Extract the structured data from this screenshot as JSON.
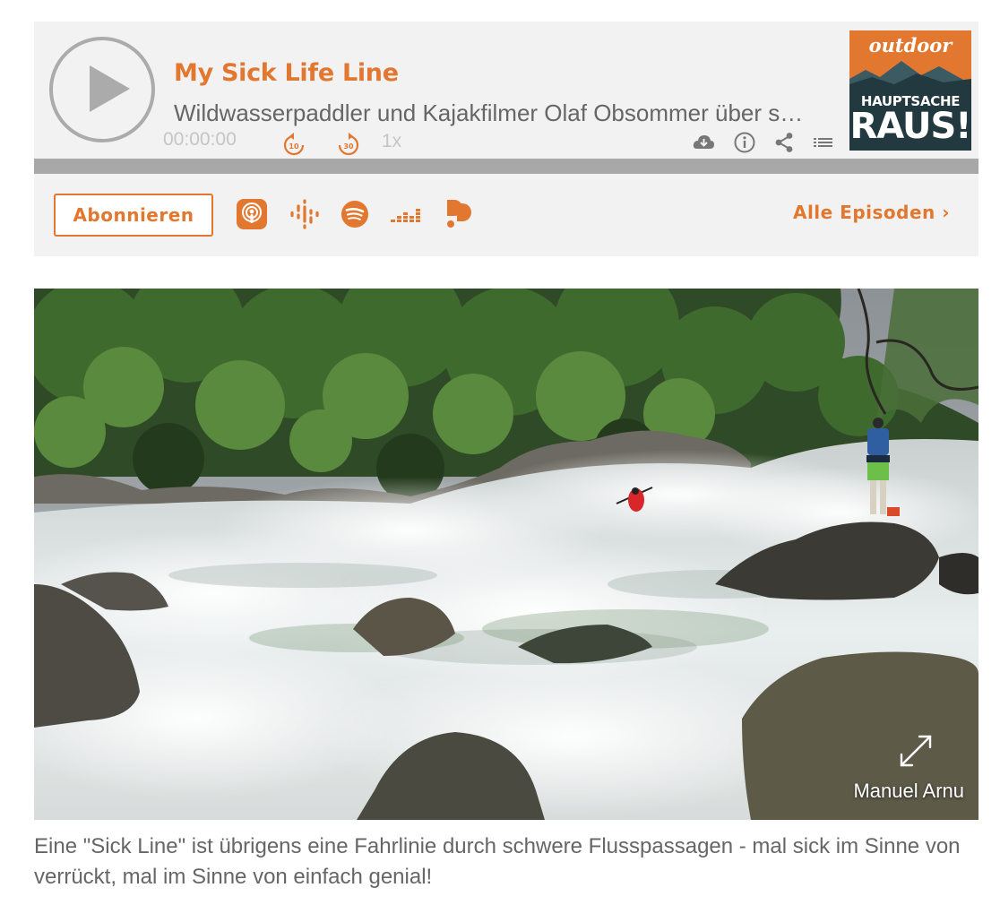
{
  "player": {
    "title": "My Sick Life Line",
    "description": "Wildwasserpaddler und Kajakfilmer Olaf Obsommer über sein Leben in der Natur",
    "time": "00:00:00",
    "skip_back_seconds": "10",
    "skip_forward_seconds": "30",
    "speed": "1x",
    "progress": 0,
    "icons": [
      "play-icon",
      "skip-back-icon",
      "skip-forward-icon",
      "download-icon",
      "info-icon",
      "share-icon",
      "playlist-icon"
    ],
    "cover": {
      "top_text": "outdoor",
      "line1": "HAUPTSACHE",
      "line2": "RAUS!"
    },
    "subscribe_label": "Abonnieren",
    "platforms": [
      "apple-podcasts-icon",
      "google-podcasts-icon",
      "spotify-icon",
      "deezer-icon",
      "podimo-icon"
    ],
    "all_episodes_label": "Alle Episoden ›"
  },
  "photo": {
    "credit": "Manuel Arnu",
    "alt_icon": "expand-icon"
  },
  "caption": "Eine \"Sick Line\" ist übrigens eine Fahrlinie durch schwere Flusspassagen - mal sick im Sinne von verrückt, mal im Sinne von einfach genial!",
  "colors": {
    "accent": "#e2772f",
    "player_bg": "#f2f2f2",
    "progress_track": "#a8a8a8",
    "muted": "#c5c5c5"
  }
}
